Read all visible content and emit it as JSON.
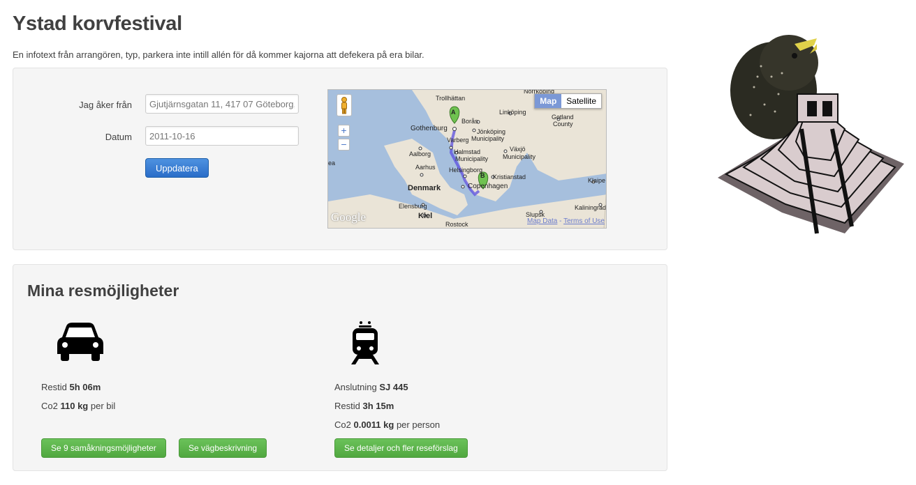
{
  "page": {
    "title": "Ystad korvfestival",
    "intro": "En infotext från arrangören, typ, parkera inte intill allén för då kommer kajorna att defekera på era bilar."
  },
  "form": {
    "from_label": "Jag åker från",
    "from_value": "Gjutjärnsgatan 11, 417 07 Göteborg,",
    "date_label": "Datum",
    "date_value": "2011-10-16",
    "update_button": "Uppdatera"
  },
  "map": {
    "toggle_map": "Map",
    "toggle_satellite": "Satellite",
    "zoom_in": "+",
    "zoom_out": "−",
    "marker_a": "A",
    "marker_b": "B",
    "labels": {
      "gothenburg": "Gothenburg",
      "boras": "Borås",
      "jonkoping": "Jönköping",
      "jonkoping_muni": "Municipality",
      "linkoping": "Linköping",
      "gotland": "Gotland",
      "gotland_county": "County",
      "varberg": "Varberg",
      "halmstad": "Halmstad",
      "halmstad_muni": "Municipality",
      "vaxjo": "Växjö",
      "vaxjo_muni": "Municipality",
      "aalborg": "Aalborg",
      "aarhus": "Aarhus",
      "helsingborg": "Helsingborg",
      "kristianstad": "Kristianstad",
      "copenhagen": "Copenhagen",
      "denmark": "Denmark",
      "klaipeda": "Klaipe",
      "elensburg": "Elensburg",
      "kiel": "Kiel",
      "slupsk": "Slupsk",
      "kaliningrad": "Kaliningrad",
      "rostock": "Rostock",
      "trollhattan": "Trollhättan",
      "norrkoping": "Norrköping",
      "ea": "ea"
    },
    "google_logo": "Google",
    "map_data": "Map Data",
    "separator": " - ",
    "terms": "Terms of Use"
  },
  "options": {
    "heading": "Mina resmöjligheter",
    "car": {
      "icon": "car-icon",
      "restid_label": "Restid",
      "restid_value": "5h 06m",
      "co2_label": "Co2",
      "co2_value": "110 kg",
      "co2_unit": "per bil",
      "carpool_button": "Se 9 samåkningsmöjligheter",
      "route_button": "Se vägbeskrivning"
    },
    "train": {
      "icon": "train-icon",
      "connection_label": "Anslutning",
      "connection_value": "SJ 445",
      "restid_label": "Restid",
      "restid_value": "3h 15m",
      "co2_label": "Co2",
      "co2_value": "0.0011 kg",
      "co2_unit": "per person",
      "details_button": "Se detaljer och fler reseförslag"
    }
  },
  "colors": {
    "primary": "#2a6dc8",
    "success": "#5cb84a",
    "well_bg": "#f5f5f5"
  }
}
